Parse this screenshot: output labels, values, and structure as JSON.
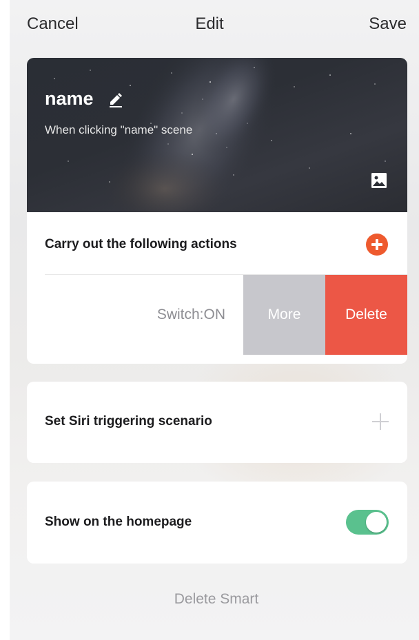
{
  "nav": {
    "cancel_label": "Cancel",
    "title": "Edit",
    "save_label": "Save"
  },
  "scene": {
    "name": "name",
    "description": "When clicking \"name\" scene",
    "edit_icon": "pencil-icon",
    "image_icon": "image-icon"
  },
  "actions": {
    "title": "Carry out the following actions",
    "add_icon": "add-circle-icon",
    "items": [
      {
        "label": "Switch:ON",
        "more_label": "More",
        "delete_label": "Delete"
      }
    ]
  },
  "siri": {
    "label": "Set Siri triggering scenario",
    "add_icon": "plus-icon"
  },
  "homepage": {
    "label": "Show on the homepage",
    "toggle_on": true
  },
  "footer": {
    "delete_label": "Delete Smart"
  },
  "colors": {
    "accent_orange": "#ee5a2e",
    "delete_red": "#ec5746",
    "more_gray": "#c7c7cc",
    "toggle_green": "#5ac18e"
  }
}
